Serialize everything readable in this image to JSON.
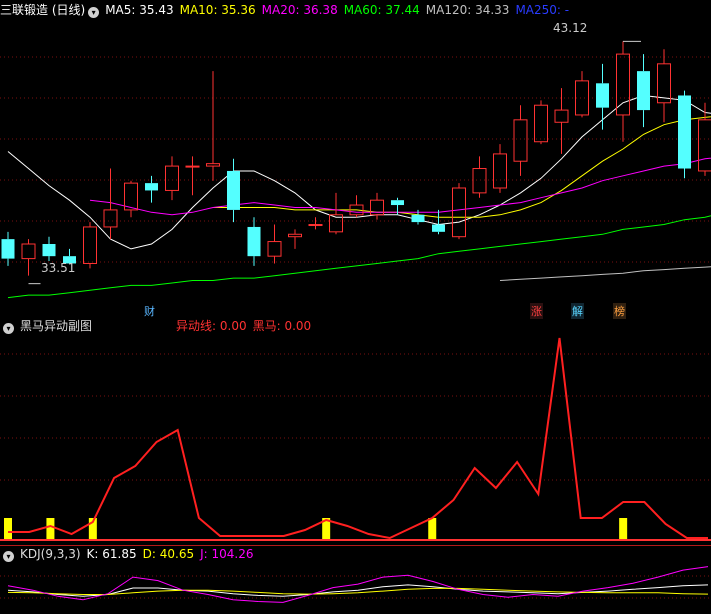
{
  "main": {
    "title": "三联锻造 (日线)",
    "ma": [
      {
        "label": "MA5: 35.43",
        "color": "#ffffff"
      },
      {
        "label": "MA10: 35.36",
        "color": "#ffff00"
      },
      {
        "label": "MA20: 36.38",
        "color": "#ff00ff"
      },
      {
        "label": "MA60: 37.44",
        "color": "#00ff00"
      },
      {
        "label": "MA120: 34.33",
        "color": "#c0c0c0"
      },
      {
        "label": "MA250: -",
        "color": "#0000ff"
      }
    ],
    "high_label": "43.12",
    "low_label": "33.51",
    "tags": [
      {
        "text": "财",
        "color": "#59b6ff"
      },
      {
        "text": "涨",
        "color": "#ff4040"
      },
      {
        "text": "解",
        "color": "#59d5ff"
      },
      {
        "text": "榜",
        "color": "#ffa040"
      }
    ]
  },
  "sub1": {
    "title": "黑马异动副图",
    "line_label": "异动线: 0.00",
    "horse_label": "黑马: 0.00"
  },
  "sub2": {
    "title": "KDJ(9,3,3)",
    "k_label": "K: 61.85",
    "d_label": "D: 40.65",
    "j_label": "J: 104.26"
  },
  "colors": {
    "up": "#ff3232",
    "down": "#54ffff",
    "signal": "#ffff00"
  },
  "chart_data": [
    {
      "type": "candlestick",
      "title": "三联锻造 (日线)",
      "price_range": [
        32.5,
        44.0
      ],
      "series": [
        {
          "name": "K",
          "ohlc": [
            [
              35.0,
              35.3,
              33.9,
              34.2
            ],
            [
              34.2,
              35.0,
              33.5,
              34.8
            ],
            [
              34.8,
              35.1,
              34.1,
              34.3
            ],
            [
              34.3,
              34.6,
              34.0,
              34.0
            ],
            [
              34.0,
              35.7,
              33.8,
              35.5
            ],
            [
              35.5,
              37.9,
              35.0,
              36.2
            ],
            [
              36.2,
              37.4,
              35.9,
              37.3
            ],
            [
              37.3,
              37.6,
              36.5,
              37.0
            ],
            [
              37.0,
              38.4,
              36.6,
              38.0
            ],
            [
              38.0,
              38.4,
              36.8,
              38.0
            ],
            [
              38.0,
              41.9,
              37.4,
              38.1
            ],
            [
              37.8,
              38.3,
              35.7,
              36.2
            ],
            [
              35.5,
              35.9,
              33.9,
              34.3
            ],
            [
              34.3,
              35.6,
              34.0,
              34.9
            ],
            [
              35.1,
              35.4,
              34.6,
              35.2
            ],
            [
              35.6,
              35.9,
              35.4,
              35.6
            ],
            [
              35.3,
              36.9,
              35.2,
              36.0
            ],
            [
              36.0,
              36.8,
              35.9,
              36.4
            ],
            [
              36.0,
              36.9,
              35.8,
              36.6
            ],
            [
              36.6,
              36.7,
              36.0,
              36.4
            ],
            [
              36.0,
              36.2,
              35.6,
              35.7
            ],
            [
              35.6,
              36.2,
              35.2,
              35.3
            ],
            [
              35.1,
              37.3,
              35.0,
              37.1
            ],
            [
              36.9,
              38.4,
              36.7,
              37.9
            ],
            [
              37.1,
              38.9,
              36.9,
              38.5
            ],
            [
              38.2,
              40.5,
              37.6,
              39.9
            ],
            [
              39.0,
              40.7,
              38.9,
              40.5
            ],
            [
              39.8,
              41.2,
              38.5,
              40.3
            ],
            [
              40.1,
              41.9,
              40.0,
              41.5
            ],
            [
              41.4,
              42.2,
              39.5,
              40.4
            ],
            [
              40.1,
              43.12,
              39.0,
              42.6
            ],
            [
              41.9,
              42.6,
              39.6,
              40.3
            ],
            [
              40.6,
              42.8,
              39.8,
              42.2
            ],
            [
              40.9,
              41.1,
              37.5,
              37.9
            ],
            [
              37.8,
              40.6,
              37.6,
              39.9
            ],
            [
              40.1,
              41.5,
              38.5,
              41.2
            ],
            [
              42.2,
              42.6,
              40.8,
              41.9
            ],
            [
              41.9,
              42.0,
              39.4,
              39.8
            ],
            [
              39.9,
              40.1,
              37.2,
              38.3
            ],
            [
              38.7,
              39.6,
              38.0,
              38.8
            ]
          ]
        }
      ],
      "ma_series": [
        {
          "name": "MA5",
          "values": [
            38.6,
            37.9,
            37.2,
            36.6,
            35.9,
            35.0,
            34.6,
            34.8,
            35.4,
            36.3,
            37.1,
            37.8,
            37.8,
            37.4,
            36.9,
            36.2,
            35.9,
            35.9,
            36.0,
            36.0,
            35.8,
            35.6,
            35.7,
            36.0,
            36.4,
            36.9,
            37.5,
            38.3,
            39.2,
            39.9,
            40.6,
            40.9,
            40.8,
            40.7,
            40.2,
            40.1,
            40.2,
            40.2,
            39.9,
            39.6
          ]
        },
        {
          "name": "MA10",
          "values": [
            null,
            null,
            null,
            null,
            null,
            null,
            null,
            null,
            null,
            null,
            36.3,
            36.3,
            36.3,
            36.3,
            36.2,
            36.2,
            36.2,
            36.2,
            36.1,
            36.1,
            36.0,
            35.9,
            35.9,
            35.9,
            36.0,
            36.2,
            36.5,
            37.0,
            37.6,
            38.2,
            38.7,
            39.3,
            39.7,
            39.9,
            40.0,
            40.1,
            40.2,
            40.3,
            40.1,
            39.9
          ]
        },
        {
          "name": "MA20",
          "values": [
            null,
            null,
            null,
            null,
            36.6,
            36.5,
            36.3,
            36.1,
            36.0,
            36.1,
            36.3,
            36.4,
            36.5,
            36.4,
            36.3,
            36.3,
            36.2,
            36.1,
            36.1,
            36.1,
            36.1,
            36.1,
            36.2,
            36.3,
            36.4,
            36.5,
            36.7,
            36.9,
            37.1,
            37.4,
            37.6,
            37.8,
            38.0,
            38.1,
            38.3,
            38.4,
            38.6,
            38.7,
            38.7,
            38.6
          ]
        },
        {
          "name": "MA60",
          "values": [
            32.6,
            32.7,
            32.7,
            32.8,
            32.9,
            33.0,
            33.1,
            33.1,
            33.2,
            33.3,
            33.3,
            33.4,
            33.4,
            33.5,
            33.6,
            33.7,
            33.8,
            33.9,
            34.0,
            34.1,
            34.2,
            34.4,
            34.5,
            34.6,
            34.7,
            34.8,
            34.9,
            35.0,
            35.1,
            35.2,
            35.4,
            35.5,
            35.6,
            35.8,
            35.9,
            36.1,
            36.2,
            36.3,
            36.5,
            36.6
          ]
        },
        {
          "name": "MA120",
          "values": [
            null,
            null,
            null,
            null,
            null,
            null,
            null,
            null,
            null,
            null,
            null,
            null,
            null,
            null,
            null,
            null,
            null,
            null,
            null,
            null,
            null,
            null,
            null,
            null,
            33.3,
            33.35,
            33.4,
            33.45,
            33.5,
            33.55,
            33.6,
            33.7,
            33.75,
            33.8,
            33.85,
            33.9,
            34.0,
            34.05,
            34.1,
            34.15
          ]
        }
      ]
    },
    {
      "type": "line",
      "title": "黑马异动副图",
      "y_range": [
        0,
        100
      ],
      "series": [
        {
          "name": "异动线",
          "values": [
            3,
            3,
            6,
            2,
            8,
            30,
            36,
            48,
            54,
            10,
            1,
            1,
            1,
            1,
            4,
            9,
            6,
            2,
            0,
            5,
            10,
            19,
            35,
            25,
            38,
            22,
            100,
            10,
            10,
            18,
            18,
            7,
            0,
            0
          ]
        },
        {
          "name": "黑马",
          "values": [
            1,
            0,
            1,
            0,
            1,
            0,
            0,
            0,
            0,
            0,
            0,
            0,
            0,
            0,
            0,
            1,
            0,
            0,
            0,
            0,
            1,
            0,
            0,
            0,
            0,
            0,
            0,
            0,
            0,
            1,
            0,
            0,
            0,
            0
          ]
        }
      ]
    },
    {
      "type": "line",
      "title": "KDJ(9,3,3)",
      "y_range": [
        0,
        100
      ],
      "series": [
        {
          "name": "K",
          "values": [
            50,
            46,
            40,
            36,
            40,
            55,
            55,
            50,
            48,
            42,
            38,
            36,
            40,
            46,
            50,
            58,
            62,
            58,
            52,
            48,
            46,
            44,
            42,
            45,
            48,
            52,
            56,
            60,
            62
          ]
        },
        {
          "name": "D",
          "values": [
            45,
            44,
            42,
            40,
            40,
            44,
            48,
            50,
            50,
            48,
            45,
            42,
            41,
            42,
            44,
            48,
            52,
            54,
            54,
            52,
            50,
            48,
            46,
            45,
            44,
            44,
            44,
            42,
            41
          ]
        },
        {
          "name": "J",
          "values": [
            60,
            50,
            36,
            28,
            42,
            80,
            72,
            50,
            40,
            28,
            24,
            22,
            38,
            56,
            64,
            80,
            84,
            70,
            52,
            40,
            34,
            40,
            36,
            48,
            56,
            66,
            80,
            96,
            104
          ]
        }
      ]
    }
  ]
}
